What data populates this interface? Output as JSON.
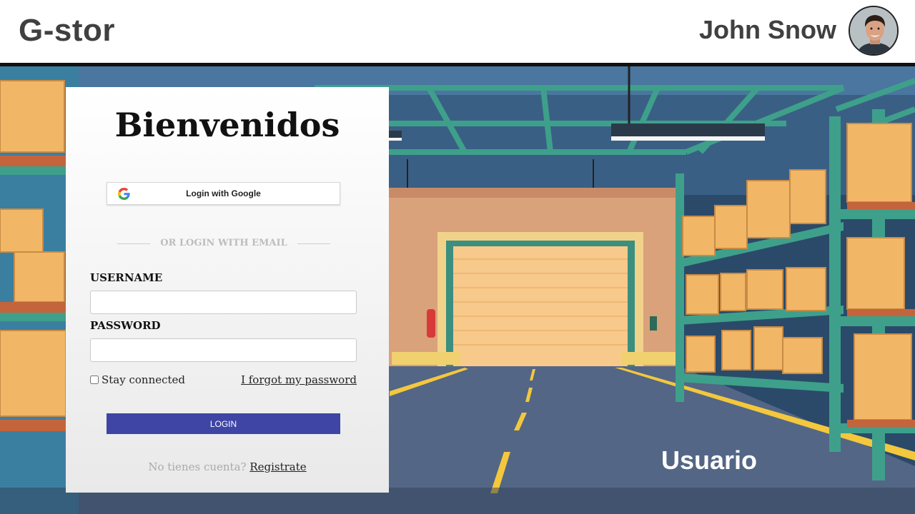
{
  "header": {
    "brand": "G-stor",
    "user_name": "John Snow"
  },
  "login": {
    "title": "Bienvenidos",
    "google_button": "Login with Google",
    "divider": "OR LOGIN WITH EMAIL",
    "username_label": "USERNAME",
    "username_value": "",
    "password_label": "PASSWORD",
    "password_value": "",
    "stay_connected": "Stay connected",
    "forgot_password": "I forgot my password",
    "login_button": "LOGIN",
    "no_account": "No tienes cuenta?",
    "register_link": "Registrate"
  },
  "scene": {
    "role_label": "Usuario"
  },
  "colors": {
    "login_button": "#3e45a5",
    "header_text": "#404040"
  }
}
